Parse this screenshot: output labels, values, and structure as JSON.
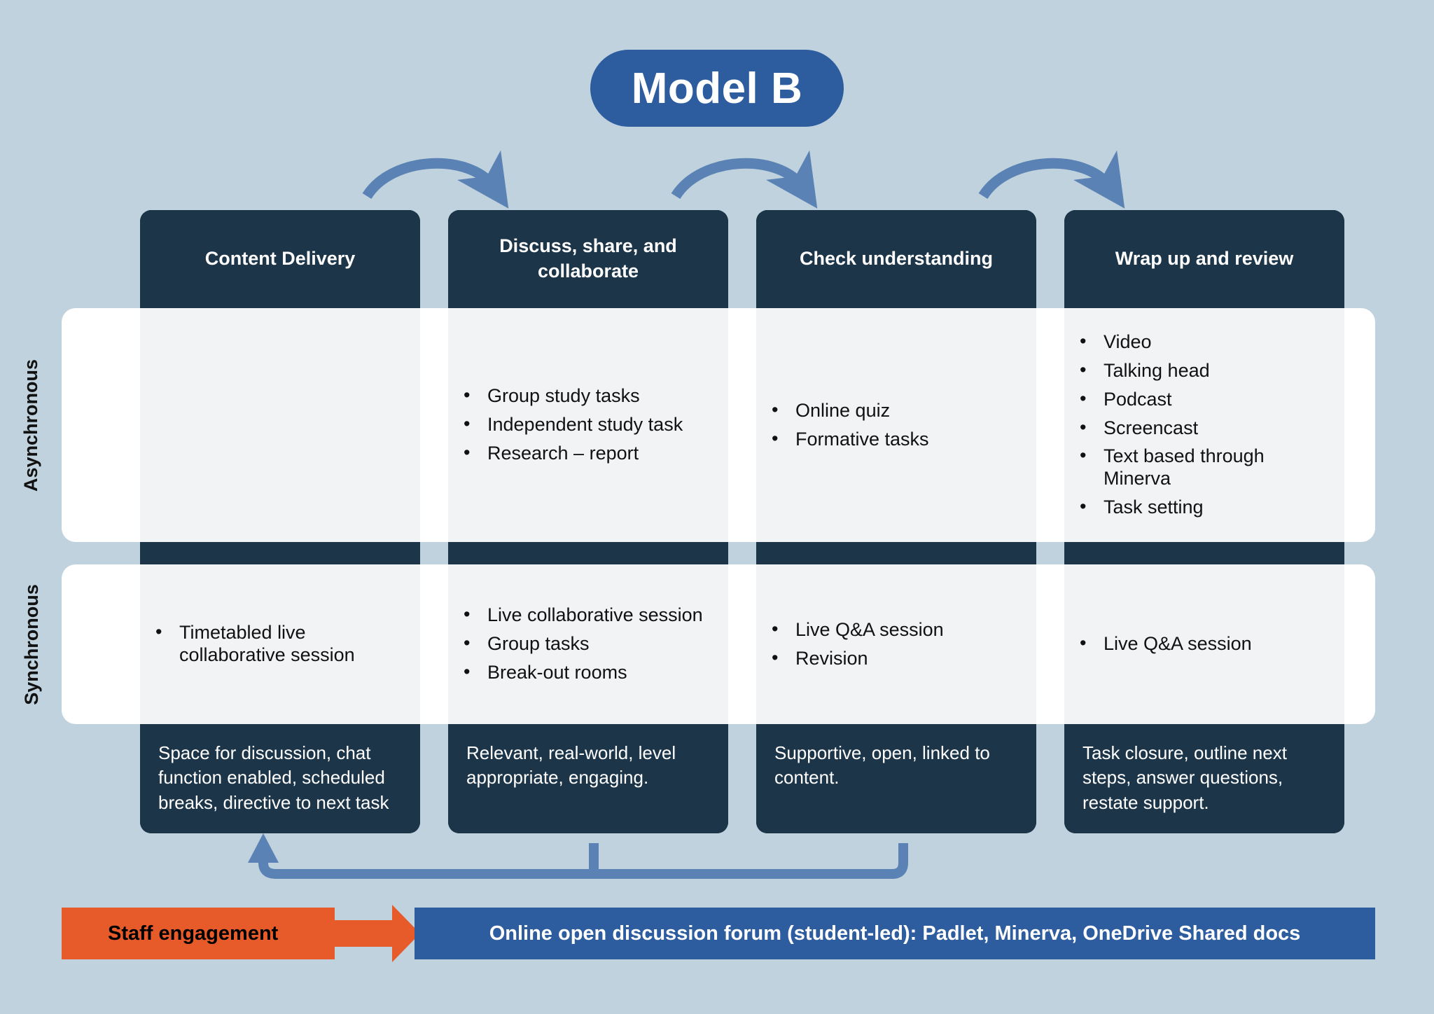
{
  "title": {
    "text": "Model B"
  },
  "rows": [
    {
      "id": "async",
      "label": "Asynchronous"
    },
    {
      "id": "sync",
      "label": "Synchronous"
    }
  ],
  "columns": [
    {
      "header": "Content Delivery",
      "asynchronous": [],
      "synchronous": [
        "Timetabled live collaborative session"
      ],
      "footer": "Space for discussion, chat function enabled, scheduled breaks, directive to next task"
    },
    {
      "header": "Discuss, share, and collaborate",
      "asynchronous": [
        "Group study tasks",
        "Independent study task",
        "Research – report"
      ],
      "synchronous": [
        "Live collaborative session",
        "Group tasks",
        "Break-out rooms"
      ],
      "footer": "Relevant, real-world, level appropriate, engaging."
    },
    {
      "header": "Check understanding",
      "asynchronous": [
        "Online quiz",
        "Formative tasks"
      ],
      "synchronous": [
        "Live Q&A session",
        "Revision"
      ],
      "footer": "Supportive, open, linked to content."
    },
    {
      "header": "Wrap up and review",
      "asynchronous": [
        "Video",
        "Talking head",
        "Podcast",
        "Screencast",
        "Text based through Minerva",
        "Task setting"
      ],
      "synchronous": [
        "Live Q&A session"
      ],
      "footer": "Task closure, outline next steps, answer questions, restate support."
    }
  ],
  "bottom_bar": {
    "staff_engagement_label": "Staff engagement",
    "forum_label": "Online open discussion forum (student-led): Padlet, Minerva, OneDrive Shared docs"
  },
  "colors": {
    "background": "#bfd2dd",
    "dark_navy": "#1c3549",
    "title_blue": "#2d5d9f",
    "arrow_blue": "#5b82b4",
    "orange": "#e75b2b",
    "cell_grey": "#f1f3f5",
    "band_white": "#ffffff"
  },
  "flow_arrows": [
    {
      "from": "Content Delivery",
      "to": "Discuss, share, and collaborate"
    },
    {
      "from": "Discuss, share, and collaborate",
      "to": "Check understanding"
    },
    {
      "from": "Check understanding",
      "to": "Wrap up and review"
    }
  ],
  "feedback_loop": {
    "description": "return loop from later stages back to Content Delivery"
  }
}
